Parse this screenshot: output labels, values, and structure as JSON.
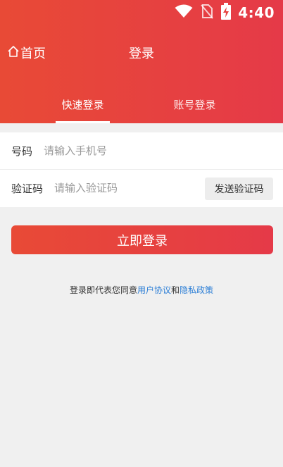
{
  "status_bar": {
    "time": "4:40",
    "icons": [
      "wifi-icon",
      "no-sim-icon",
      "battery-charging-icon"
    ]
  },
  "nav": {
    "home_label": "首页",
    "home_icon": "home-icon",
    "title": "登录"
  },
  "tabs": [
    {
      "label": "快速登录",
      "active": true
    },
    {
      "label": "账号登录",
      "active": false
    }
  ],
  "form": {
    "phone_label": "号码",
    "phone_placeholder": "请输入手机号",
    "code_label": "验证码",
    "code_placeholder": "请输入验证码",
    "send_code_label": "发送验证码"
  },
  "login_button_label": "立即登录",
  "agreement": {
    "prefix": "登录即代表您同意",
    "user_agreement": "用户协议",
    "conjunction": "和",
    "privacy_policy": "隐私政策"
  },
  "colors": {
    "brand_start": "#e84a36",
    "brand_end": "#e53a48",
    "link": "#2d7fd6",
    "background": "#f0f0f0"
  }
}
